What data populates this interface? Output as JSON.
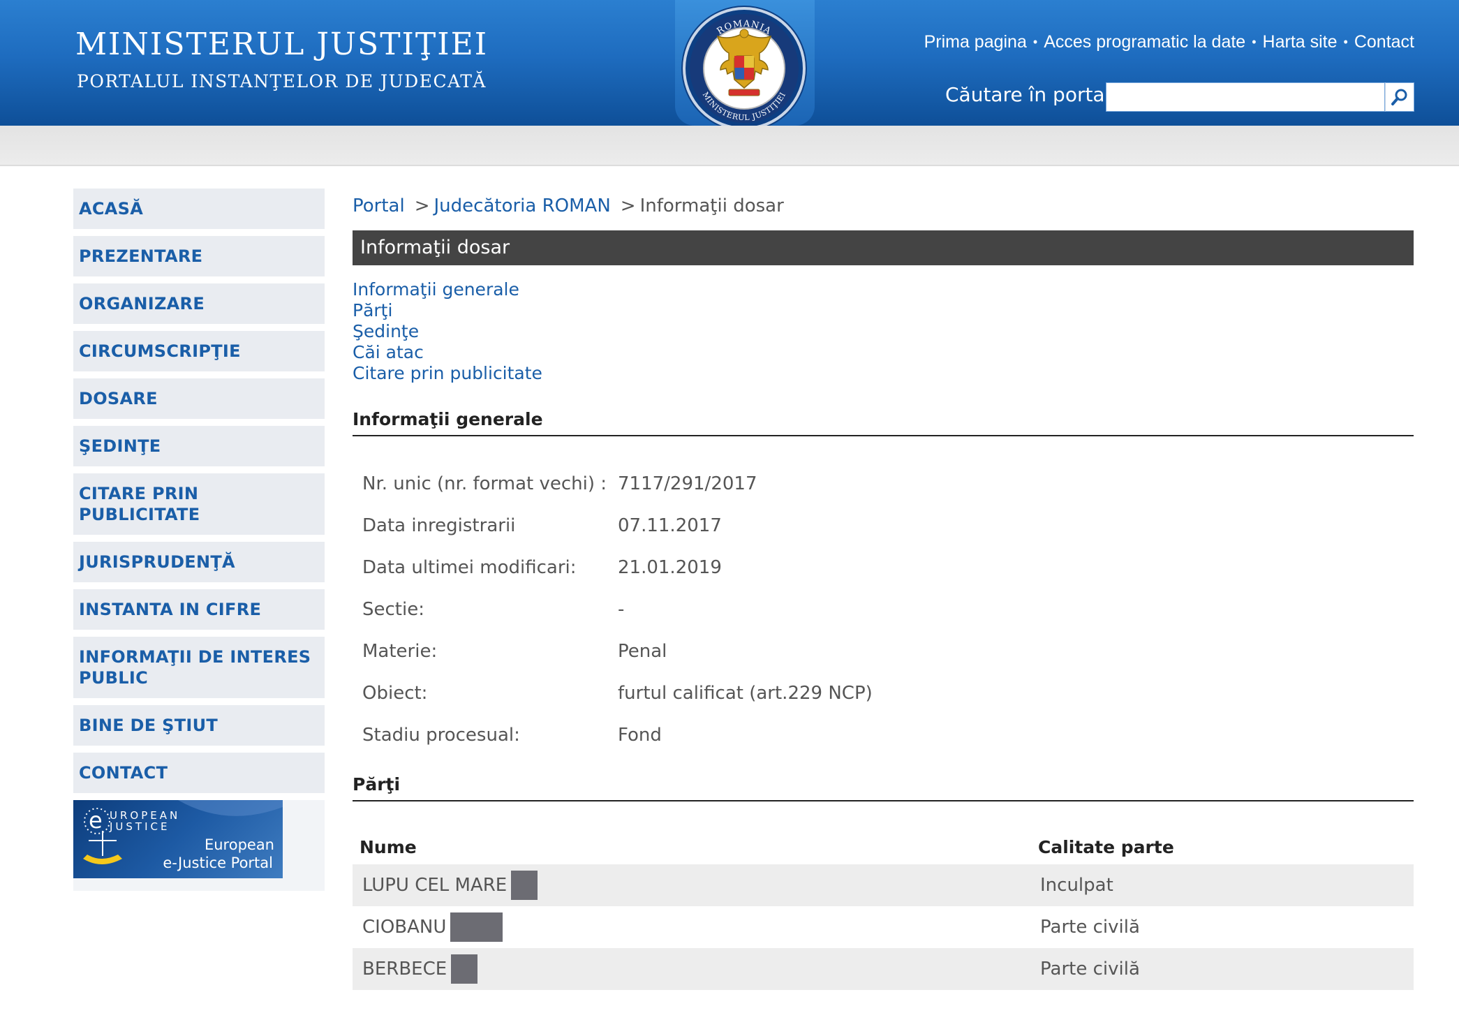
{
  "header": {
    "title": "MINISTERUL JUSTIŢIEI",
    "subtitle": "PORTALUL INSTANŢELOR DE JUDECATĂ",
    "seal_top_text": "ROMANIA",
    "seal_bottom_text": "MINISTERUL JUSTIŢIEI",
    "nav": [
      "Prima pagina",
      "Acces programatic la date",
      "Harta site",
      "Contact"
    ],
    "nav_separator": "•",
    "search_label": "Căutare în portal",
    "search_value": "",
    "search_placeholder": ""
  },
  "sidebar": {
    "items": [
      "ACASĂ",
      "PREZENTARE",
      "ORGANIZARE",
      "CIRCUMSCRIPŢIE",
      "DOSARE",
      "ŞEDINŢE",
      "CITARE PRIN PUBLICITATE",
      "JURISPRUDENŢĂ",
      "INSTANTA IN CIFRE",
      "INFORMAŢII DE INTERES PUBLIC",
      "BINE DE ŞTIUT",
      "CONTACT"
    ],
    "banner": {
      "logo_line1": "UROPEAN",
      "logo_line2": "JUSTICE",
      "line1": "European",
      "line2": "e-Justice Portal"
    }
  },
  "breadcrumb": {
    "items": [
      "Portal",
      "Judecătoria ROMAN",
      "Informaţii dosar"
    ],
    "separator": ">"
  },
  "page_title": "Informaţii dosar",
  "anchors": [
    "Informaţii generale",
    "Părţi",
    "Şedinţe",
    "Căi atac",
    "Citare prin publicitate"
  ],
  "general": {
    "heading": "Informaţii generale",
    "rows": [
      {
        "label": "Nr. unic (nr. format vechi) :",
        "value": "7117/291/2017"
      },
      {
        "label": "Data inregistrarii",
        "value": "07.11.2017"
      },
      {
        "label": "Data ultimei modificari:",
        "value": "21.01.2019"
      },
      {
        "label": "Sectie:",
        "value": "-"
      },
      {
        "label": "Materie:",
        "value": "Penal"
      },
      {
        "label": "Obiect:",
        "value": "furtul calificat (art.229 NCP)"
      },
      {
        "label": "Stadiu procesual:",
        "value": "Fond"
      }
    ]
  },
  "parti": {
    "heading": "Părţi",
    "columns": [
      "Nume",
      "Calitate parte"
    ],
    "rows": [
      {
        "name": "LUPU CEL MARE",
        "role": "Inculpat"
      },
      {
        "name": "CIOBANU",
        "role": "Parte civilă"
      },
      {
        "name": "BERBECE",
        "role": "Parte civilă"
      }
    ]
  },
  "colors": {
    "header_blue": "#1e6cbf",
    "link_blue": "#1a5ea8",
    "title_bar": "#444444",
    "sidebar_bg": "#e9ecf1",
    "redaction": "#6c6c73"
  }
}
